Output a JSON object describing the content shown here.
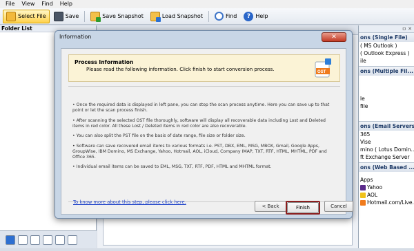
{
  "menu": [
    "File",
    "View",
    "Find",
    "Help"
  ],
  "toolbar": {
    "select_file": "Select File",
    "save": "Save",
    "save_snapshot": "Save Snapshot",
    "load_snapshot": "Load Snapshot",
    "find": "Find",
    "help": "Help"
  },
  "left_pane": {
    "header": "Folder List"
  },
  "right_pane": {
    "sections": [
      {
        "title": "ons (Single File)",
        "items": [
          "( MS Outlook )",
          "( Outlook Express )",
          "ile"
        ]
      },
      {
        "title": "ons (Multiple Fil...",
        "items": [
          "le",
          "file"
        ]
      },
      {
        "title": "ons (Email Servers)",
        "items": [
          "365",
          "Vise",
          "mino ( Lotus Domin...",
          "ft Exchange Server"
        ]
      },
      {
        "title": "ons (Web Based ...",
        "items": [
          "Apps",
          "Yahoo",
          "AOL",
          "Hotmail.com/Live.com/Outl..."
        ]
      }
    ]
  },
  "dialog": {
    "title": "Information",
    "close": "✕",
    "header_title": "Process Information",
    "header_subtitle": "Please read the following information. Click finish to start conversion process.",
    "bullets": [
      "• Once the required data is displayed in left pane, you can stop the scan process anytime. Here you can save up to that point or let the scan process finish.",
      "• After scanning the selected OST file thoroughly, software will display all recoverable data including Lost and Deleted items in red color. All these Lost / Deleted items in red color are also recoverable.",
      "• You can also split the PST file on the basis of date range, file size or folder size.",
      "• Software can save recovered email items to various formats i.e. PST, DBX, EML, MSG, MBOX, Gmail, Google Apps, GroupWise, IBM Domino, MS Exchange, Yahoo, Hotmail, AOL, iCloud, Company IMAP, TXT, RTF, HTML, MHTML, PDF and Office 365.",
      "• Individual email items can be saved to EML, MSG, TXT, RTF, PDF, HTML and MHTML format."
    ],
    "more_link": "To know more about this step, please click here.",
    "back_label": "< Back",
    "finish_label": "Finish",
    "cancel_label": "Cancel"
  }
}
